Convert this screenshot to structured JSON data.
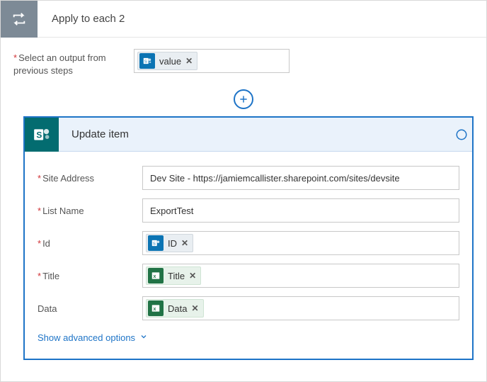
{
  "outer": {
    "title": "Apply to each 2",
    "select_output_label": "Select an output from previous steps",
    "token": {
      "label": "value",
      "source": "sharepoint"
    }
  },
  "inner": {
    "title": "Update item",
    "advanced_link": "Show advanced options",
    "fields": {
      "site_address": {
        "label": "Site Address",
        "required": true,
        "value": "Dev Site - https://jamiemcallister.sharepoint.com/sites/devsite"
      },
      "list_name": {
        "label": "List Name",
        "required": true,
        "value": "ExportTest"
      },
      "id": {
        "label": "Id",
        "required": true,
        "token": {
          "label": "ID",
          "source": "sharepoint"
        }
      },
      "title": {
        "label": "Title",
        "required": true,
        "token": {
          "label": "Title",
          "source": "excel"
        }
      },
      "data": {
        "label": "Data",
        "required": false,
        "token": {
          "label": "Data",
          "source": "excel"
        }
      }
    }
  },
  "icons": {
    "loop": "loop-icon",
    "sharepoint": "sharepoint-icon",
    "excel": "excel-icon",
    "add": "add-icon",
    "remove": "remove-icon",
    "info": "info-icon",
    "chevron_down": "chevron-down-icon"
  }
}
